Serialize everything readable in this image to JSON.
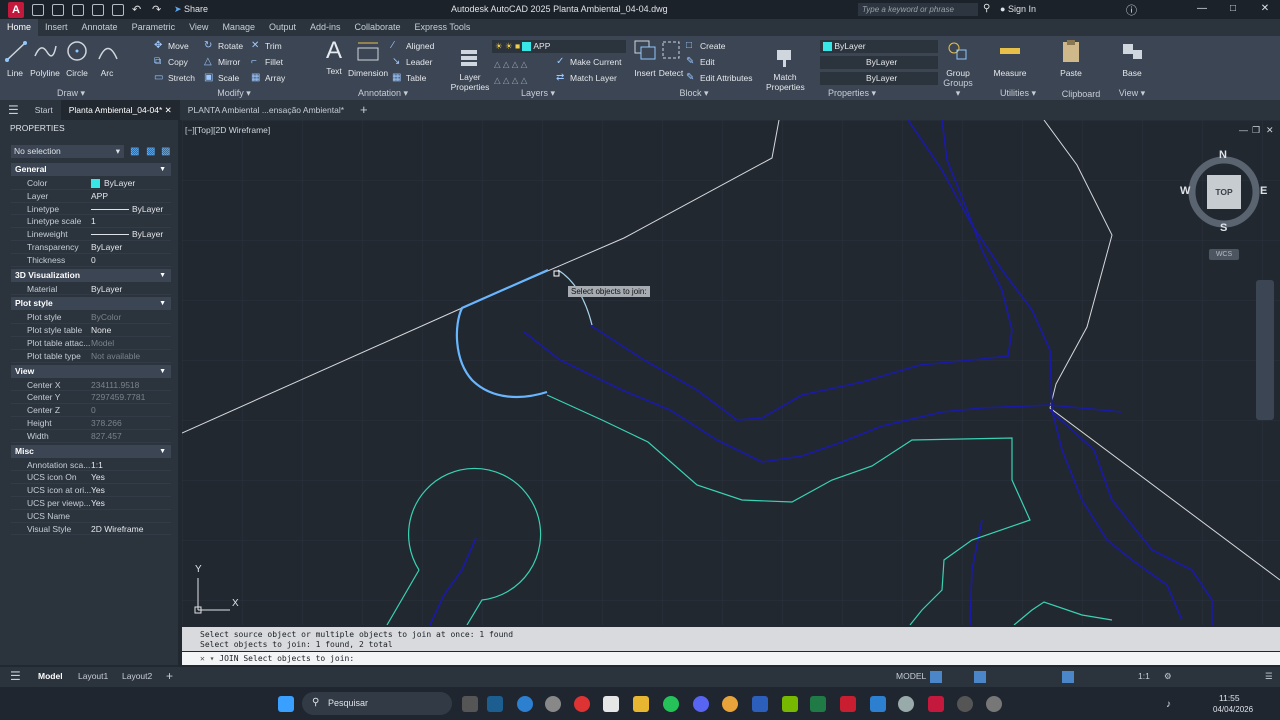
{
  "titlebar": {
    "app_logo": "A",
    "share": "Share",
    "title": "Autodesk AutoCAD 2025   Planta Ambiental_04-04.dwg",
    "search_placeholder": "Type a keyword or phrase",
    "signin": "Sign In"
  },
  "ribbon_tabs": [
    "Home",
    "Insert",
    "Annotate",
    "Parametric",
    "View",
    "Manage",
    "Output",
    "Add-ins",
    "Collaborate",
    "Express Tools"
  ],
  "ribbon": {
    "draw": {
      "title": "Draw",
      "tools": [
        "Line",
        "Polyline",
        "Circle",
        "Arc"
      ]
    },
    "modify": {
      "title": "Modify",
      "tools": [
        "Move",
        "Rotate",
        "Trim",
        "Copy",
        "Mirror",
        "Fillet",
        "Stretch",
        "Scale",
        "Array"
      ]
    },
    "annotation": {
      "title": "Annotation",
      "big": [
        "Text",
        "Dimension"
      ],
      "small": [
        "Aligned",
        "Leader",
        "Table"
      ]
    },
    "layers": {
      "title": "Layers",
      "big": "Layer\nProperties",
      "current_layer": "APP",
      "small": [
        "Make Current",
        "Match Layer"
      ]
    },
    "block": {
      "title": "Block",
      "big": [
        "Insert",
        "Detect"
      ],
      "small": [
        "Create",
        "Edit",
        "Edit Attributes"
      ]
    },
    "properties": {
      "title": "Properties",
      "big": "Match\nProperties",
      "color": "ByLayer",
      "linetype": "ByLayer",
      "lineweight": "ByLayer"
    },
    "groups": {
      "title": "Groups",
      "big": "Group"
    },
    "utilities": {
      "title": "Utilities",
      "big": "Measure"
    },
    "clipboard": {
      "title": "Clipboard",
      "big": "Paste"
    },
    "view": {
      "title": "View",
      "big": "Base"
    }
  },
  "file_tabs": [
    "Start",
    "Planta Ambiental_04-04*",
    "PLANTA Ambiental ...ensação Ambiental*"
  ],
  "properties": {
    "header": "PROPERTIES",
    "selection": "No selection",
    "sections": [
      {
        "title": "General",
        "rows": [
          [
            "Color",
            "ByLayer"
          ],
          [
            "Layer",
            "APP"
          ],
          [
            "Linetype",
            "ByLayer"
          ],
          [
            "Linetype scale",
            "1"
          ],
          [
            "Lineweight",
            "ByLayer"
          ],
          [
            "Transparency",
            "ByLayer"
          ],
          [
            "Thickness",
            "0"
          ]
        ]
      },
      {
        "title": "3D Visualization",
        "rows": [
          [
            "Material",
            "ByLayer"
          ]
        ]
      },
      {
        "title": "Plot style",
        "rows": [
          [
            "Plot style",
            "ByColor"
          ],
          [
            "Plot style table",
            "None"
          ],
          [
            "Plot table attac...",
            "Model"
          ],
          [
            "Plot table type",
            "Not available"
          ]
        ]
      },
      {
        "title": "View",
        "rows": [
          [
            "Center X",
            "234111.9518"
          ],
          [
            "Center Y",
            "7297459.7781"
          ],
          [
            "Center Z",
            "0"
          ],
          [
            "Height",
            "378.266"
          ],
          [
            "Width",
            "827.457"
          ]
        ]
      },
      {
        "title": "Misc",
        "rows": [
          [
            "Annotation sca...",
            "1:1"
          ],
          [
            "UCS icon On",
            "Yes"
          ],
          [
            "UCS icon at ori...",
            "Yes"
          ],
          [
            "UCS per viewp...",
            "Yes"
          ],
          [
            "UCS Name",
            ""
          ],
          [
            "Visual Style",
            "2D Wireframe"
          ]
        ]
      }
    ]
  },
  "viewport": {
    "label": "[−][Top][2D Wireframe]",
    "tooltip": "Select objects to join:",
    "viewcube": {
      "n": "N",
      "s": "S",
      "e": "E",
      "w": "W",
      "face": "TOP",
      "wcs": "WCS"
    },
    "ucs_x": "X",
    "ucs_y": "Y"
  },
  "command": {
    "history": [
      "Select source object or multiple objects to join at once: 1 found",
      "Select objects to join: 1 found, 2 total"
    ],
    "prompt": "JOIN Select objects to join:"
  },
  "layout_tabs": [
    "Model",
    "Layout1",
    "Layout2"
  ],
  "status": {
    "mode": "MODEL",
    "scale": "1:1"
  },
  "taskbar": {
    "search": "Pesquisar",
    "time": "11:55",
    "date": "04/04/2026"
  },
  "colors": {
    "accent": "#3b8fd6",
    "contour_teal": "#39d3b4",
    "contour_blue": "#1a1aa8",
    "selected": "#69b6ff",
    "line_white": "#d6d8dc"
  }
}
